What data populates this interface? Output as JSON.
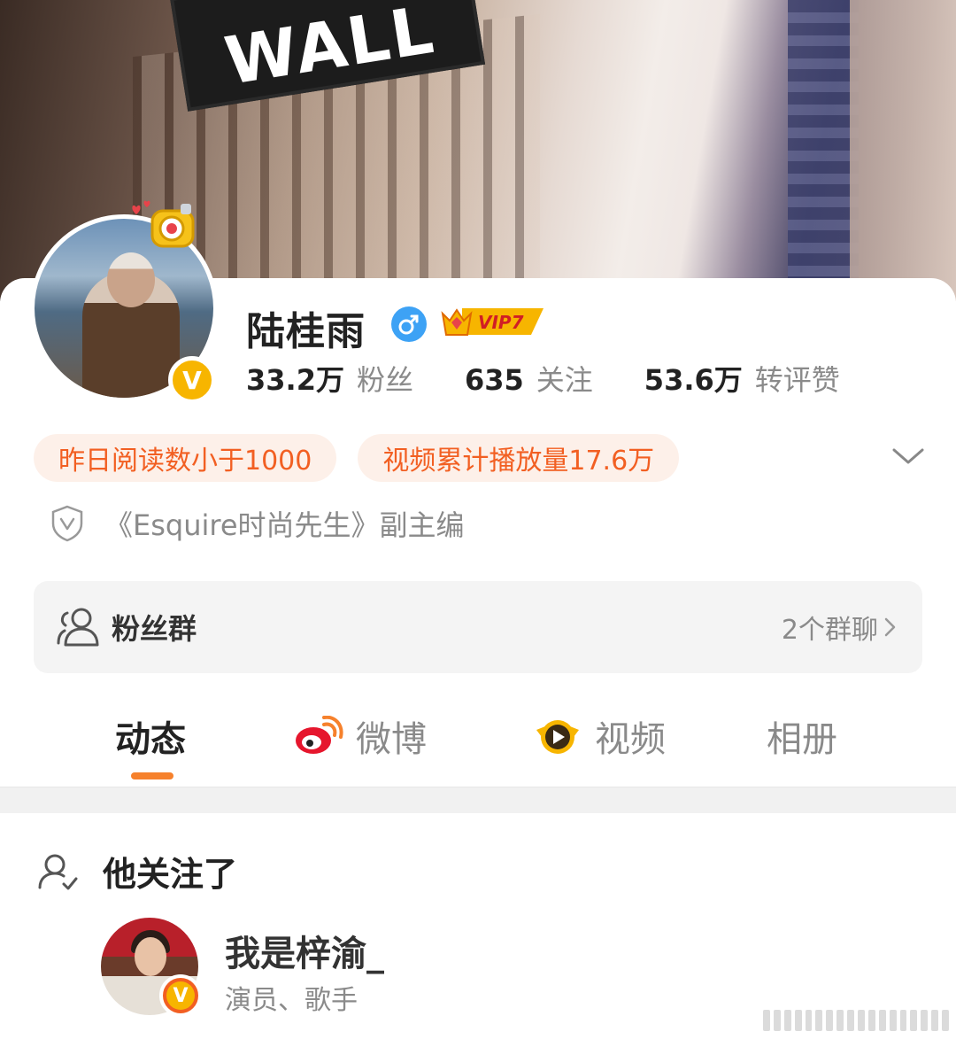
{
  "cover": {
    "sign_text": "WALL"
  },
  "profile": {
    "name": "陆桂雨",
    "gender_icon": "male-icon",
    "vip_label": "VIP7",
    "verified_badge": "V",
    "stats": [
      {
        "num": "33.2万",
        "label": "粉丝"
      },
      {
        "num": "635",
        "label": "关注"
      },
      {
        "num": "53.6万",
        "label": "转评赞"
      }
    ],
    "tags": [
      "昨日阅读数小于1000",
      "视频累计播放量17.6万"
    ],
    "certification": "《Esquire时尚先生》副主编"
  },
  "fan_group": {
    "title": "粉丝群",
    "count": "2个群聊"
  },
  "tabs": [
    {
      "label": "动态",
      "icon": ""
    },
    {
      "label": "微博",
      "icon": "weibo-icon"
    },
    {
      "label": "视频",
      "icon": "video-icon"
    },
    {
      "label": "相册",
      "icon": ""
    }
  ],
  "following": {
    "heading": "他关注了",
    "user": {
      "name": "我是梓渝_",
      "desc": "演员、歌手",
      "badge": "V"
    }
  },
  "colors": {
    "accent": "#f25f22",
    "tag_bg": "#fdf0e9",
    "vip_gold": "#f7b500",
    "tab_underline": "#f6812c",
    "gender_blue": "#3da2f5"
  }
}
